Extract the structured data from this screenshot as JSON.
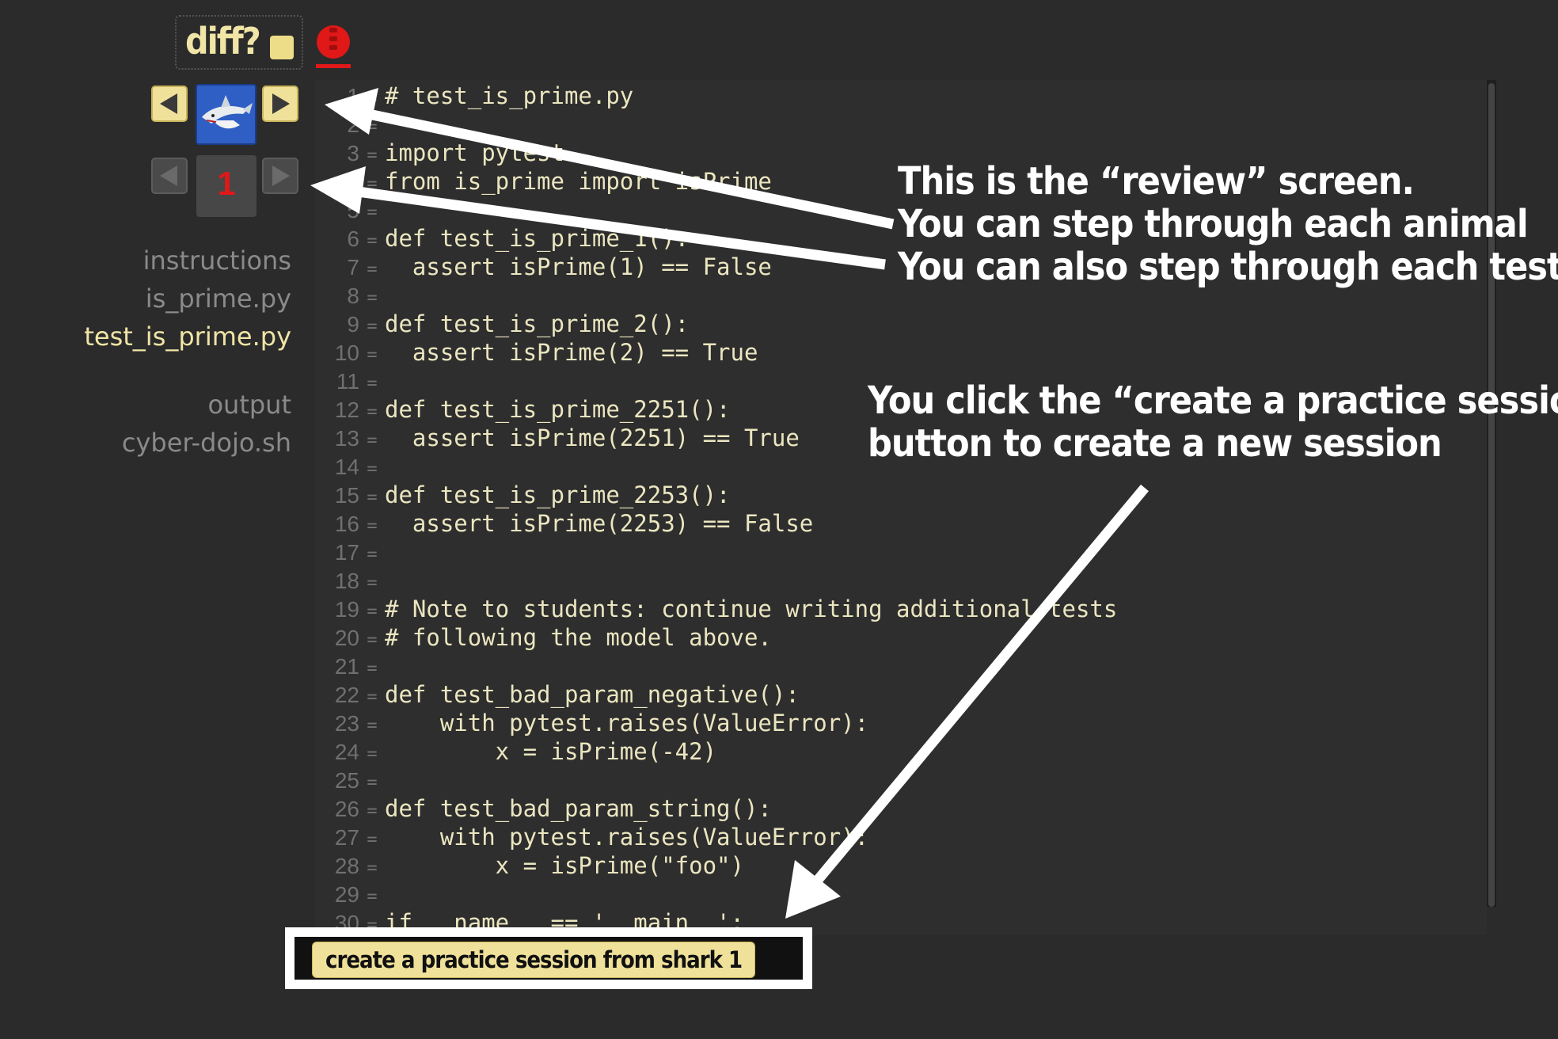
{
  "diff": {
    "label": "diff?"
  },
  "review_nav": {
    "prev_animal": "previous-animal",
    "next_animal": "next-animal",
    "test_number": "1"
  },
  "files": [
    {
      "name": "instructions",
      "selected": false
    },
    {
      "name": "is_prime.py",
      "selected": false
    },
    {
      "name": "test_is_prime.py",
      "selected": true
    },
    {
      "name": "output",
      "selected": false
    },
    {
      "name": "cyber-dojo.sh",
      "selected": false
    }
  ],
  "code_lines": [
    {
      "n": "1",
      "text": "# test_is_prime.py"
    },
    {
      "n": "2",
      "text": ""
    },
    {
      "n": "3",
      "text": "import pytest"
    },
    {
      "n": "4",
      "text": "from is_prime import isPrime"
    },
    {
      "n": "5",
      "text": ""
    },
    {
      "n": "6",
      "text": "def test_is_prime_1():"
    },
    {
      "n": "7",
      "text": "  assert isPrime(1) == False"
    },
    {
      "n": "8",
      "text": ""
    },
    {
      "n": "9",
      "text": "def test_is_prime_2():"
    },
    {
      "n": "10",
      "text": "  assert isPrime(2) == True"
    },
    {
      "n": "11",
      "text": ""
    },
    {
      "n": "12",
      "text": "def test_is_prime_2251():"
    },
    {
      "n": "13",
      "text": "  assert isPrime(2251) == True"
    },
    {
      "n": "14",
      "text": ""
    },
    {
      "n": "15",
      "text": "def test_is_prime_2253():"
    },
    {
      "n": "16",
      "text": "  assert isPrime(2253) == False"
    },
    {
      "n": "17",
      "text": ""
    },
    {
      "n": "18",
      "text": ""
    },
    {
      "n": "19",
      "text": "# Note to students: continue writing additional tests"
    },
    {
      "n": "20",
      "text": "# following the model above."
    },
    {
      "n": "21",
      "text": ""
    },
    {
      "n": "22",
      "text": "def test_bad_param_negative():"
    },
    {
      "n": "23",
      "text": "    with pytest.raises(ValueError):"
    },
    {
      "n": "24",
      "text": "        x = isPrime(-42)"
    },
    {
      "n": "25",
      "text": ""
    },
    {
      "n": "26",
      "text": "def test_bad_param_string():"
    },
    {
      "n": "27",
      "text": "    with pytest.raises(ValueError):"
    },
    {
      "n": "28",
      "text": "        x = isPrime(\"foo\")"
    },
    {
      "n": "29",
      "text": ""
    },
    {
      "n": "30",
      "text": "if __name__ == '__main__':"
    }
  ],
  "create_button": {
    "label": "create a practice session from shark 1"
  },
  "notes": {
    "review_1": "This is the “review” screen.",
    "review_2": "You can step through each animal",
    "review_3": "You can also step through each test",
    "create_1": "You click the “create a practice session”",
    "create_2": "button to create a new session"
  },
  "colors": {
    "background": "#2b2b2b",
    "accent": "#f0e19a",
    "code_text": "#ebe6c0",
    "test_number": "#e01818",
    "traffic_light": "#e01818",
    "animal_bg": "#2f5fc4"
  },
  "icons": {
    "traffic_light": "traffic-light-icon",
    "animal": "shark-avatar",
    "prev": "triangle-left-icon",
    "next": "triangle-right-icon"
  }
}
